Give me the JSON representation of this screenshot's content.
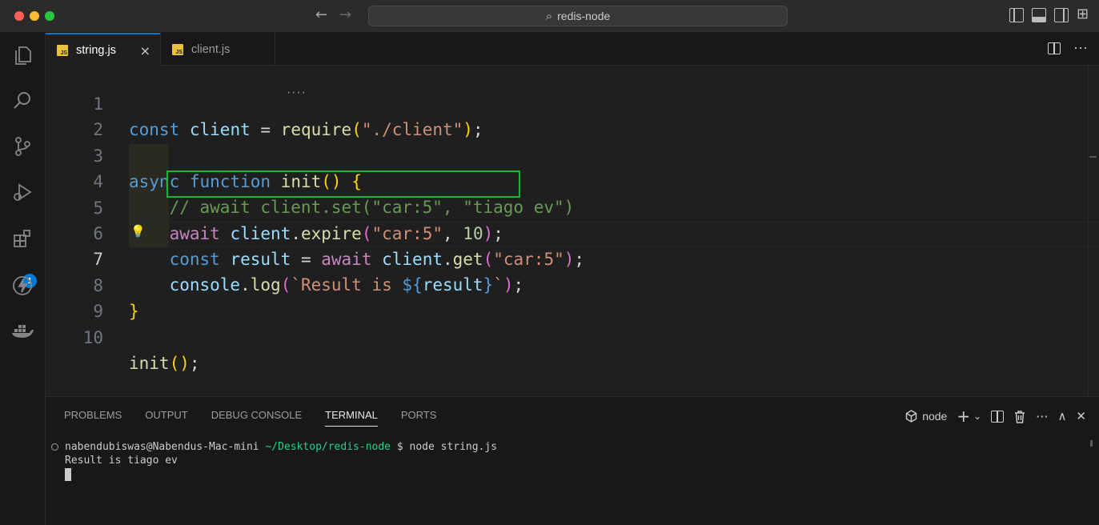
{
  "window": {
    "search_text": "redis-node",
    "nav_back": "←",
    "nav_forward": "→",
    "search_glyph": "⌕"
  },
  "activity_bar": {
    "items": [
      "explorer-icon",
      "search-icon",
      "source-control-icon",
      "run-debug-icon",
      "extensions-icon",
      "thunder-client-icon",
      "docker-icon"
    ],
    "extensions_badge": "1"
  },
  "tabs": [
    {
      "label": "string.js",
      "icon": "JS",
      "active": true
    },
    {
      "label": "client.js",
      "icon": "JS",
      "active": false
    }
  ],
  "tab_close": "×",
  "editor": {
    "line_numbers": [
      "1",
      "2",
      "3",
      "4",
      "5",
      "6",
      "7",
      "8",
      "9",
      "10"
    ],
    "current_line": "7"
  },
  "panel": {
    "tabs": [
      "PROBLEMS",
      "OUTPUT",
      "DEBUG CONSOLE",
      "TERMINAL",
      "PORTS"
    ],
    "active_tab": "TERMINAL",
    "terminal_name": "node",
    "add_glyph": "+",
    "chevron_glyph": "⌄",
    "maximize_glyph": "∧",
    "close_glyph": "✕"
  },
  "terminal": {
    "user_host": "nabendubiswas@Nabendus-Mac-mini",
    "path": "~/Desktop/redis-node",
    "prompt_command": "$ node string.js",
    "output": "Result is tiago ev"
  },
  "colors": {
    "accent": "#0078d4",
    "highlight_box": "#1bb33b",
    "js_icon": "#e8c33a"
  }
}
